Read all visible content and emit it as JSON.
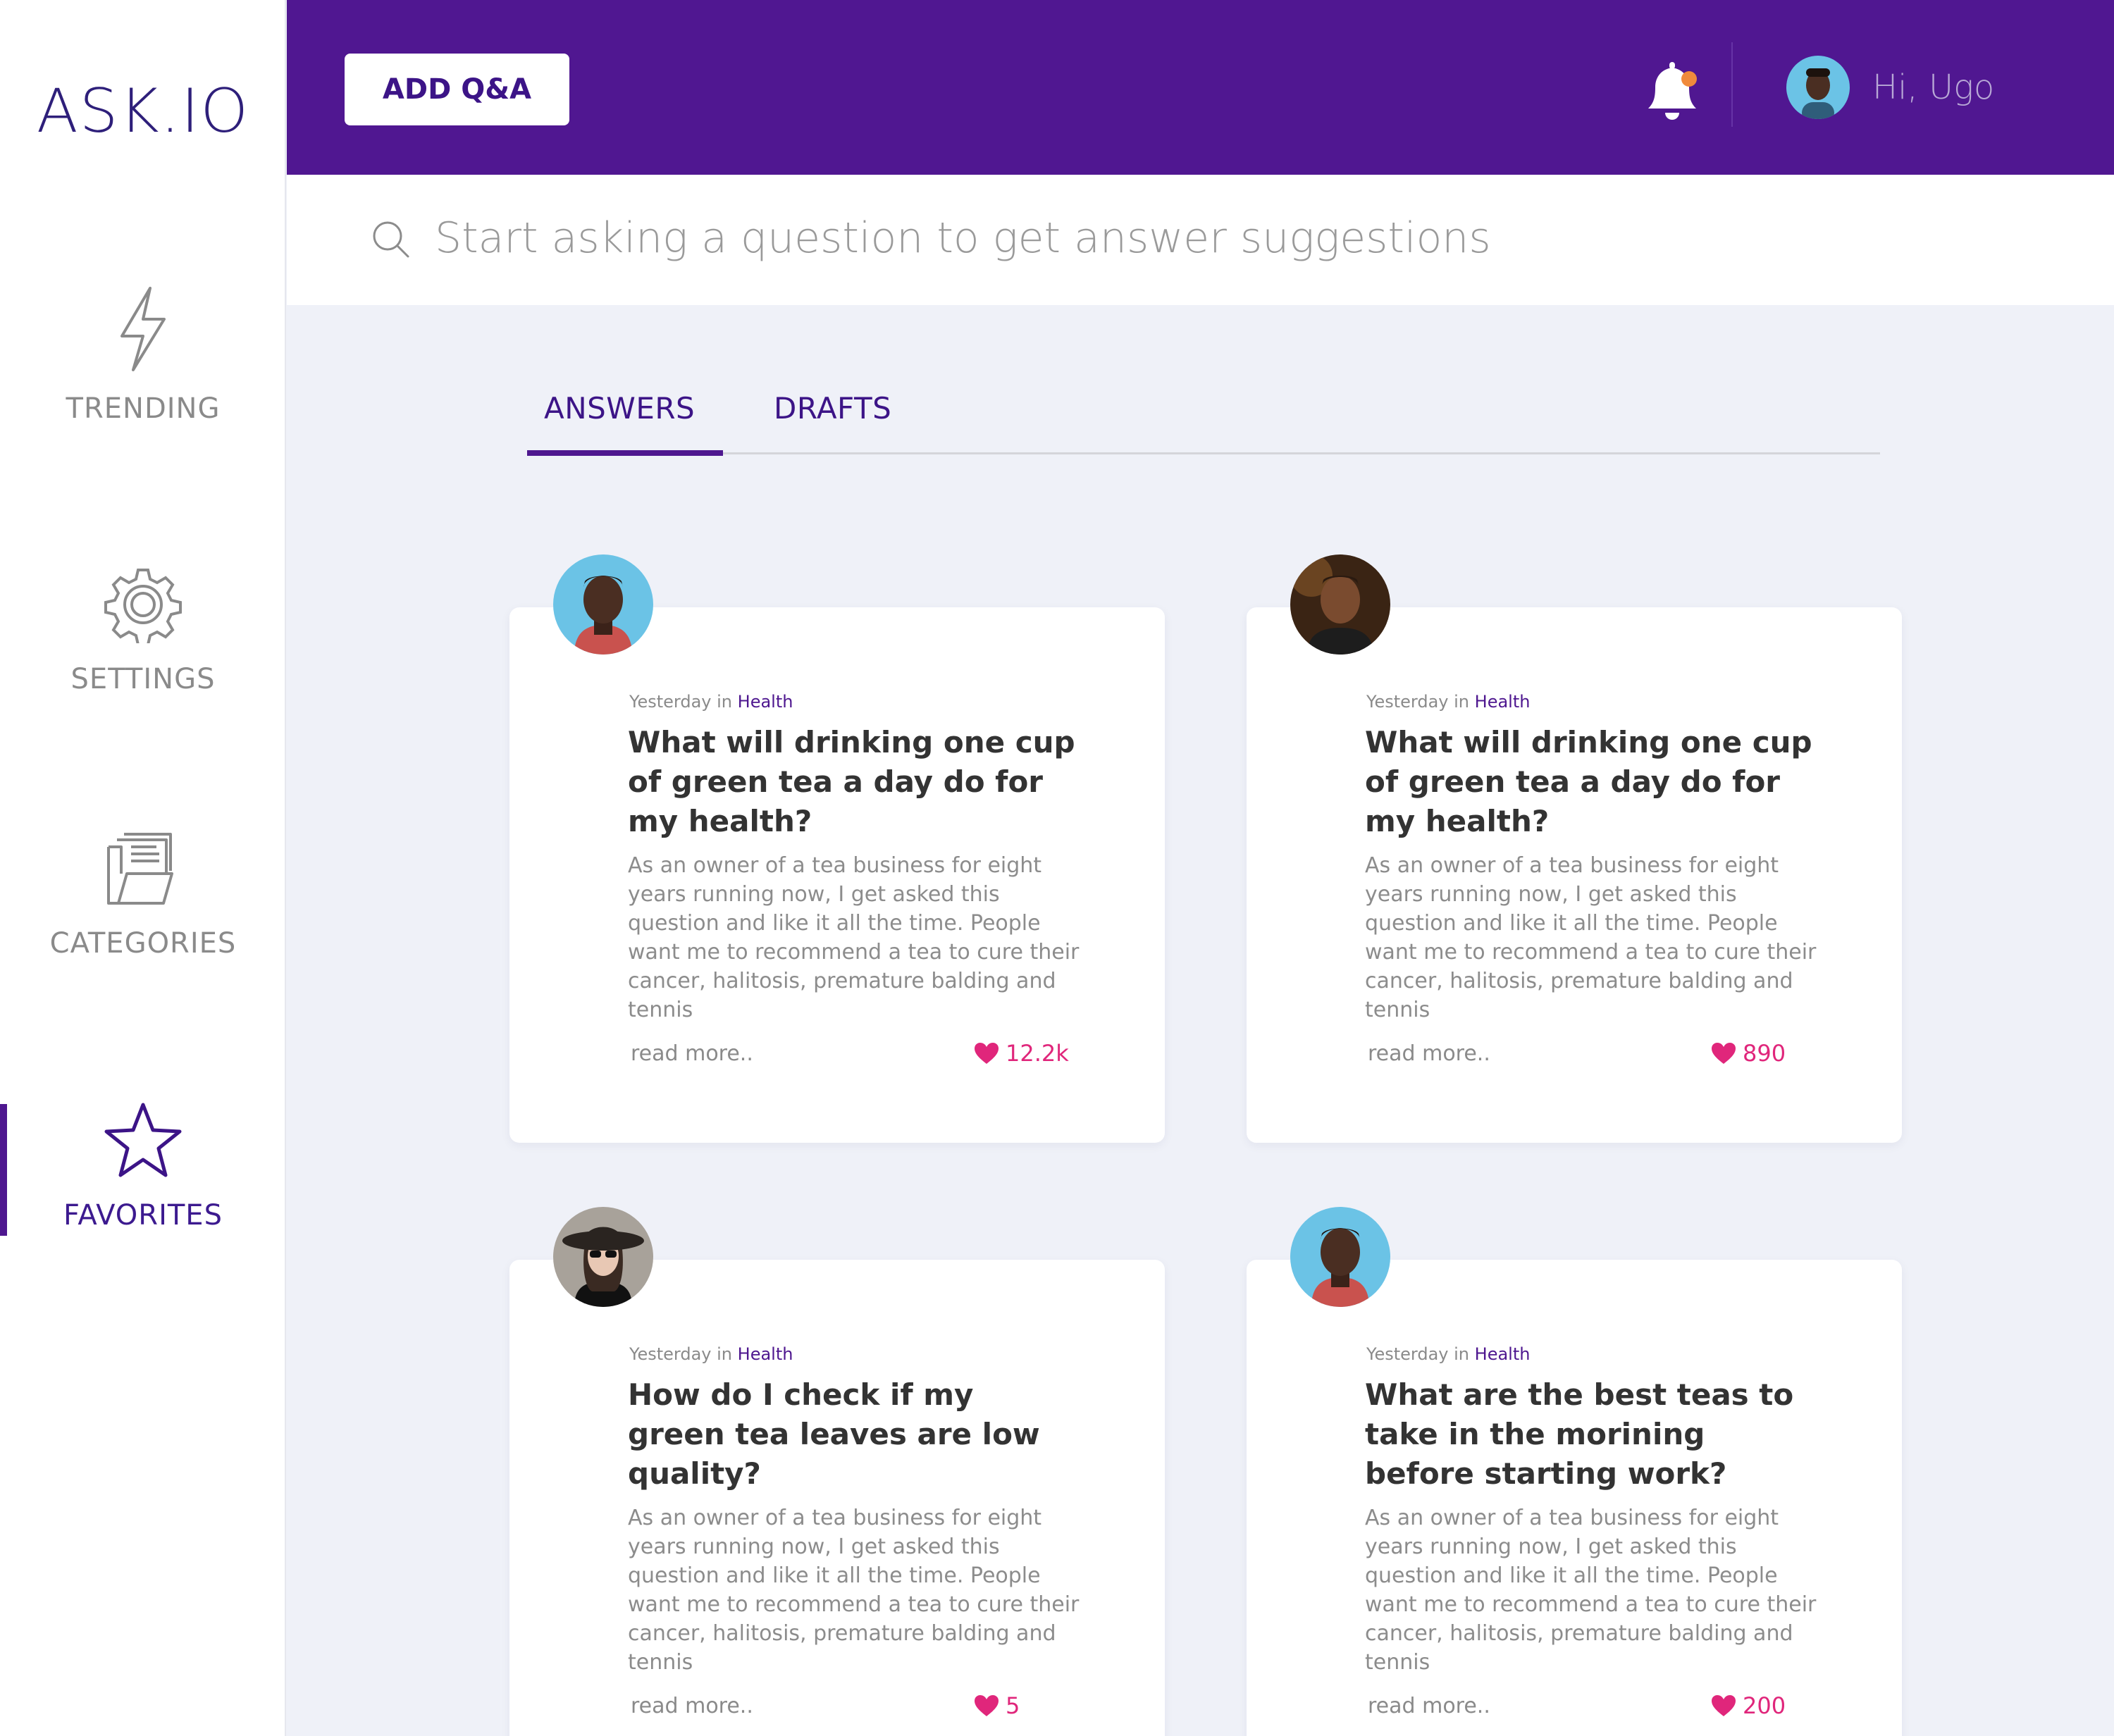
{
  "app": {
    "logo": "ASK.IO"
  },
  "sidebar": {
    "items": [
      {
        "label": "TRENDING",
        "icon": "lightning-icon",
        "active": false
      },
      {
        "label": "SETTINGS",
        "icon": "gear-icon",
        "active": false
      },
      {
        "label": "CATEGORIES",
        "icon": "folder-icon",
        "active": false
      },
      {
        "label": "FAVORITES",
        "icon": "star-icon",
        "active": true
      }
    ]
  },
  "header": {
    "add_button": "ADD Q&A",
    "greeting": "Hi, Ugo",
    "notification_dot": true
  },
  "search": {
    "placeholder": "Start asking a question to get answer suggestions"
  },
  "tabs": [
    {
      "label": "ANSWERS",
      "active": true
    },
    {
      "label": "DRAFTS",
      "active": false
    }
  ],
  "cards": [
    {
      "when": "Yesterday in",
      "category": "Health",
      "title": "What will drinking one cup of green tea a day do for my health?",
      "excerpt": "As an owner of a tea business for eight years running now, I get asked this question and like it all the time.  People want me to recommend a tea to cure their cancer, halitosis, premature balding and tennis",
      "read_more": "read more..",
      "likes": "12.2k"
    },
    {
      "when": "Yesterday in",
      "category": "Health",
      "title": "What will drinking one cup of green tea a day do for my health?",
      "excerpt": "As an owner of a tea business for eight years running now, I get asked this question and like it all the time.  People want me to recommend a tea to cure their cancer, halitosis, premature balding and tennis",
      "read_more": "read more..",
      "likes": "890"
    },
    {
      "when": "Yesterday in",
      "category": "Health",
      "title": "How do I check if my green tea leaves are low quality?",
      "excerpt": "As an owner of a tea business for eight years running now, I get asked this question and like it all the time.  People want me to recommend a tea to cure their cancer, halitosis, premature balding and tennis",
      "read_more": "read more..",
      "likes": "5"
    },
    {
      "when": "Yesterday in",
      "category": "Health",
      "title": "What are the best teas to take in the morining before starting work?",
      "excerpt": "As an owner of a tea business for eight years running now, I get asked this question and like it all the time.  People want me to recommend a tea to cure their cancer, halitosis, premature balding and tennis",
      "read_more": "read more..",
      "likes": "200"
    }
  ],
  "colors": {
    "brand": "#501791",
    "accent": "#e0267b",
    "notification": "#f08a3c",
    "background": "#eff1f8"
  }
}
